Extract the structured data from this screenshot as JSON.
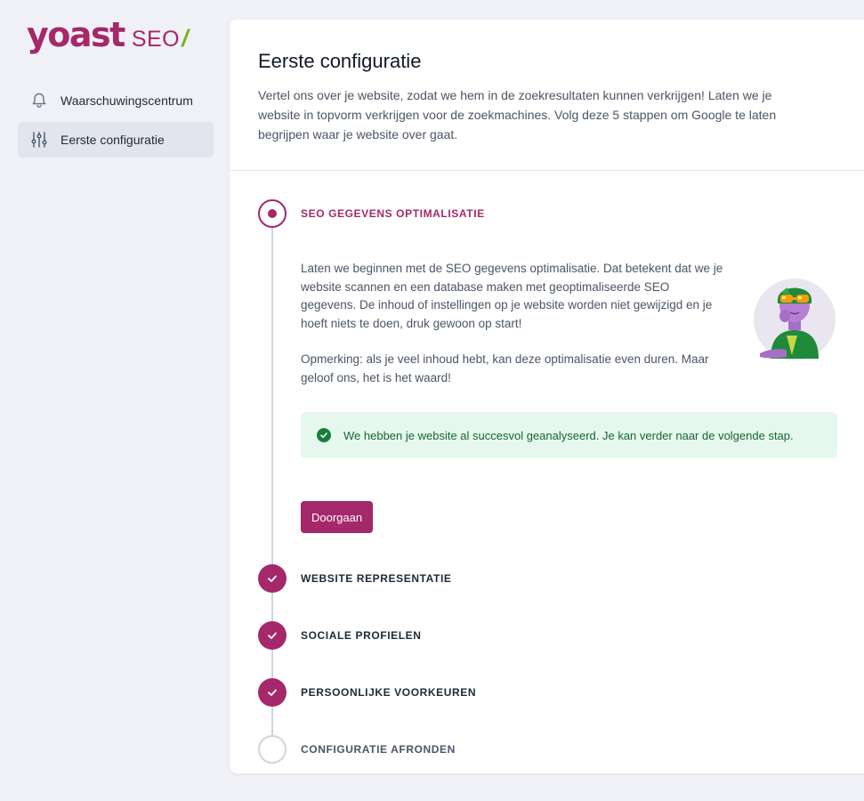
{
  "logo": {
    "brand": "yoast",
    "product": "SEO",
    "slash": "/"
  },
  "sidebar": {
    "items": [
      {
        "label": "Waarschuwingscentrum",
        "icon": "bell-icon",
        "active": false
      },
      {
        "label": "Eerste configuratie",
        "icon": "sliders-icon",
        "active": true
      }
    ]
  },
  "main": {
    "title": "Eerste configuratie",
    "intro": "Vertel ons over je website, zodat we hem in de zoekresultaten kunnen verkrijgen! Laten we je website in topvorm verkrijgen voor de zoekmachines. Volg deze 5 stappen om Google te laten begrijpen waar je website over gaat."
  },
  "steps": [
    {
      "label": "SEO GEGEVENS OPTIMALISATIE",
      "state": "active"
    },
    {
      "label": "WEBSITE REPRESENTATIE",
      "state": "done"
    },
    {
      "label": "SOCIALE PROFIELEN",
      "state": "done"
    },
    {
      "label": "PERSOONLIJKE VOORKEUREN",
      "state": "done"
    },
    {
      "label": "CONFIGURATIE AFRONDEN",
      "state": "todo"
    }
  ],
  "step1": {
    "paragraph1": "Laten we beginnen met de SEO gegevens optimalisatie. Dat betekent dat we je website scannen en een database maken met geoptimaliseerde SEO gegevens. De inhoud of instellingen op je website worden niet gewijzigd en je hoeft niets te doen, druk gewoon op start!",
    "paragraph2": "Opmerking: als je veel inhoud hebt, kan deze optimalisatie even duren. Maar geloof ons, het is het waard!",
    "success": "We hebben je website al succesvol geanalyseerd. Je kan verder naar de volgende stap.",
    "button": "Doorgaan"
  },
  "colors": {
    "brand": "#a4286a",
    "accent_green": "#77b227",
    "success_bg": "#e6f8ee",
    "success_text": "#166534"
  }
}
